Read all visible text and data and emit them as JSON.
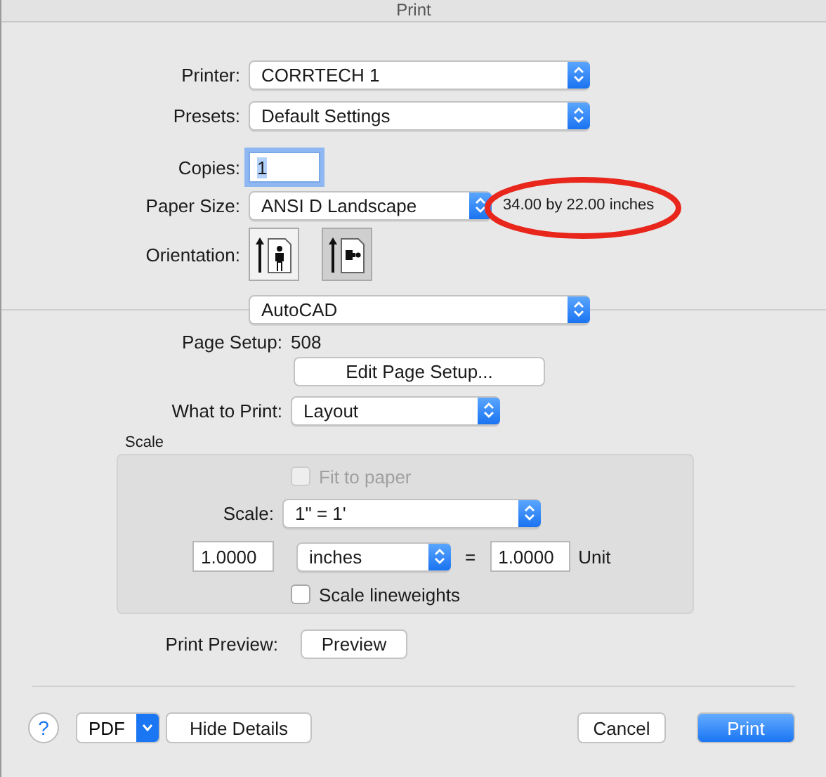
{
  "window": {
    "title": "Print"
  },
  "printer": {
    "label": "Printer:",
    "value": "CORRTECH 1"
  },
  "presets": {
    "label": "Presets:",
    "value": "Default Settings"
  },
  "copies": {
    "label": "Copies:",
    "value": "1"
  },
  "paper_size": {
    "label": "Paper Size:",
    "value": "ANSI D Landscape",
    "info": "34.00 by 22.00 inches"
  },
  "orientation": {
    "label": "Orientation:",
    "options": [
      {
        "kind": "portrait",
        "selected": false
      },
      {
        "kind": "landscape",
        "selected": true
      }
    ]
  },
  "section": {
    "value": "AutoCAD"
  },
  "page_setup": {
    "label": "Page Setup:",
    "value": "508",
    "button": "Edit Page Setup..."
  },
  "what_to_print": {
    "label": "What to Print:",
    "value": "Layout"
  },
  "scale_group": {
    "title": "Scale",
    "fit_to_paper": {
      "label": "Fit to paper",
      "checked": false,
      "disabled": true
    },
    "scale": {
      "label": "Scale:",
      "value": "1\" = 1'"
    },
    "left_value": "1.0000",
    "unit_select": "inches",
    "equals": "=",
    "right_value": "1.0000",
    "unit_label": "Unit",
    "lineweights": {
      "label": "Scale lineweights",
      "checked": false,
      "disabled": false
    }
  },
  "print_preview": {
    "label": "Print Preview:",
    "button": "Preview"
  },
  "footer": {
    "help": "?",
    "pdf": "PDF",
    "hide_details": "Hide Details",
    "cancel": "Cancel",
    "print": "Print"
  }
}
